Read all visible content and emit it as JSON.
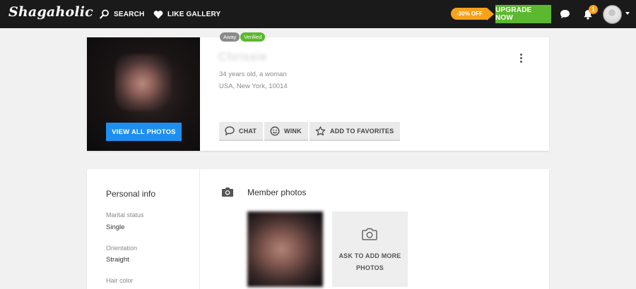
{
  "nav": {
    "logo": "Shagaholic",
    "search_label": "SEARCH",
    "like_gallery_label": "LIKE GALLERY",
    "discount_label": "-30% OFF",
    "upgrade_label": "UPGRADE NOW",
    "notification_count": "1"
  },
  "profile": {
    "status_away": "Away",
    "status_verified": "Verified",
    "name": "Chrissie",
    "age_gender": "34 years old, a woman",
    "location": "USA, New York, 10014",
    "view_photos_label": "VIEW ALL PHOTOS",
    "actions": {
      "chat": "CHAT",
      "wink": "WINK",
      "favorites": "ADD TO FAVORITES"
    }
  },
  "personal_info": {
    "title": "Personal info",
    "fields": [
      {
        "label": "Marital status",
        "value": "Single"
      },
      {
        "label": "Orientation",
        "value": "Straight"
      },
      {
        "label": "Hair color",
        "value": ""
      }
    ]
  },
  "member_photos": {
    "title": "Member photos",
    "ask_more_label": "ASK TO ADD MORE PHOTOS"
  },
  "colors": {
    "topbar": "#1a1a1a",
    "upgrade": "#5cb82e",
    "discount": "#f7a21b",
    "primary_button": "#1e8ff0",
    "verified": "#5cb82e"
  },
  "icons": [
    "search-icon",
    "heart-icon",
    "chat-bubble-icon",
    "bell-icon",
    "chat-icon",
    "smiley-icon",
    "star-icon",
    "camera-icon",
    "kebab-menu-icon"
  ]
}
